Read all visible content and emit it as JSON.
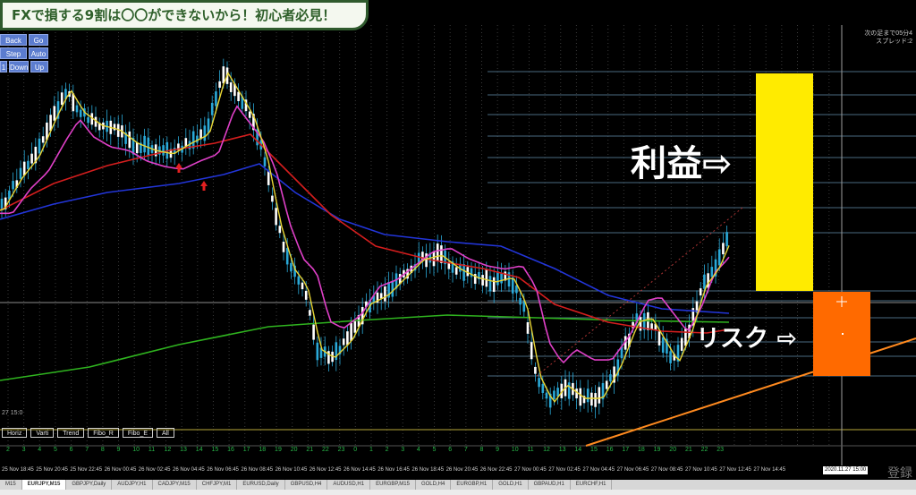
{
  "banner": {
    "title": "FXで損する9割は〇〇ができないから！初心者必見！"
  },
  "chart_buttons": [
    {
      "label": "Back"
    },
    {
      "label": "Go"
    },
    {
      "label": "Step"
    },
    {
      "label": "Auto"
    },
    {
      "label": "1"
    },
    {
      "label": "Down"
    },
    {
      "label": "Up"
    }
  ],
  "labels": {
    "profit": "利益⇨",
    "risk": "リスク ⇨"
  },
  "info_panel": {
    "line1": "次の足まで05分4",
    "line2": "スプレッド:2"
  },
  "left_stamp": "27 15:0",
  "object_buttons": [
    "Horiz",
    "Varti",
    "Trend",
    "Fibo_R",
    "Fibo_E",
    "All"
  ],
  "hours": [
    "2",
    "3",
    "4",
    "5",
    "6",
    "7",
    "8",
    "9",
    "10",
    "11",
    "12",
    "13",
    "14",
    "15",
    "16",
    "17",
    "18",
    "19",
    "20",
    "21",
    "22",
    "23",
    "0",
    "1",
    "2",
    "3",
    "4",
    "5",
    "6",
    "7",
    "8",
    "9",
    "10",
    "11",
    "12",
    "13",
    "14",
    "15",
    "16",
    "17",
    "18",
    "19",
    "20",
    "21",
    "22",
    "23"
  ],
  "dates": [
    "25 Nov 18:45",
    "25 Nov 20:45",
    "25 Nov 22:45",
    "26 Nov 00:45",
    "26 Nov 02:45",
    "26 Nov 04:45",
    "26 Nov 06:45",
    "26 Nov 08:45",
    "26 Nov 10:45",
    "26 Nov 12:45",
    "26 Nov 14:45",
    "26 Nov 16:45",
    "26 Nov 18:45",
    "26 Nov 20:45",
    "26 Nov 22:45",
    "27 Nov 00:45",
    "27 Nov 02:45",
    "27 Nov 04:45",
    "27 Nov 06:45",
    "27 Nov 08:45",
    "27 Nov 10:45",
    "27 Nov 12:45",
    "27 Nov 14:45"
  ],
  "time_box": "2020.11.27 15:00",
  "tabs": [
    "M15",
    "EURJPY,M15",
    "GBPJPY,Daily",
    "AUDJPY,H1",
    "CADJPY,M15",
    "CHFJPY,M1",
    "EURUSD,Daily",
    "GBPUSD,H4",
    "AUDUSD,H1",
    "EURGBP,M15",
    "GOLD,H4",
    "EURGBP,H1",
    "GOLD,H1",
    "GBPAUD,H1",
    "EURCHF,H1"
  ],
  "active_tab": 1,
  "watermark": "登録",
  "colors": {
    "background": "#000000",
    "candle": "#2aa9d8",
    "ma_fast": "#e8d534",
    "ma_mid": "#e040c8",
    "ma_red": "#d41e1e",
    "ma_blue": "#2235d8",
    "ma_green": "#2fb31f",
    "profit_box": "#ffeb00",
    "risk_box": "#ff6a00",
    "trend_line": "#ff8a1f",
    "banner_border": "#2f5a2d"
  }
}
